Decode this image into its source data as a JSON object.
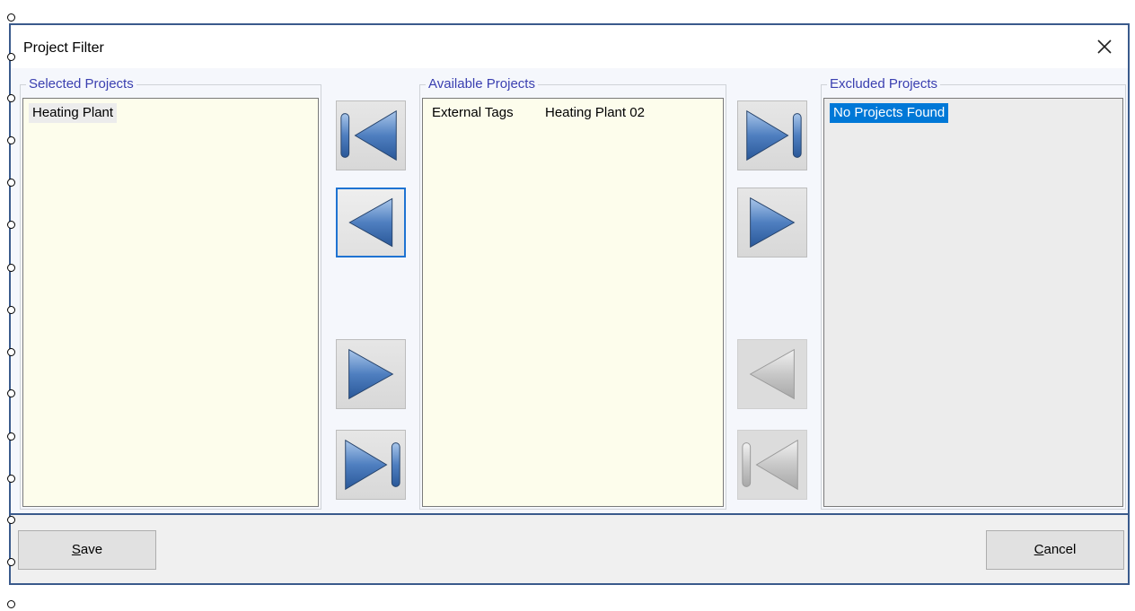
{
  "dialog": {
    "title": "Project Filter",
    "close_icon": "close-icon"
  },
  "groups": {
    "selected": {
      "label": "Selected Projects",
      "items": [
        "Heating Plant"
      ]
    },
    "available": {
      "label": "Available Projects",
      "items": [
        "External Tags",
        "Heating Plant 02"
      ]
    },
    "excluded": {
      "label": "Excluded Projects",
      "items": [
        "No Projects Found"
      ]
    }
  },
  "buttons": {
    "save": {
      "mnemonic": "S",
      "rest": "ave"
    },
    "cancel": {
      "mnemonic": "C",
      "rest": "ancel"
    }
  },
  "icons": {
    "move_all_to_selected": "move-all-left-icon",
    "move_to_selected": "move-left-icon",
    "remove_from_selected": "move-right-icon",
    "remove_all_from_selected": "move-all-right-icon",
    "move_all_to_excluded": "move-all-right-icon",
    "move_to_excluded": "move-right-icon",
    "remove_from_excluded": "move-left-icon",
    "remove_all_from_excluded": "move-all-left-icon"
  },
  "colors": {
    "list_background": "#fdfdec",
    "excluded_background": "#ececec",
    "selection_highlight": "#0078d7",
    "group_label": "#3a3fb0",
    "window_border": "#3a5a8c"
  }
}
